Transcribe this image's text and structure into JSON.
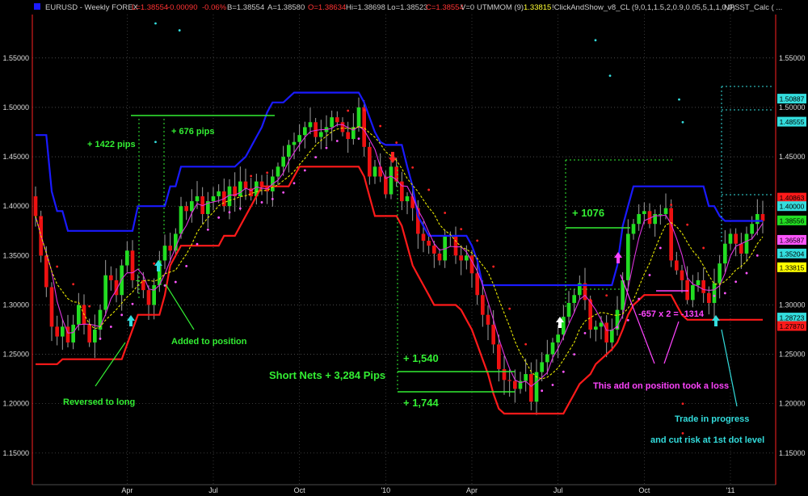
{
  "header": {
    "symbol": "EURUSD - Weekly  FOREX",
    "low": "L=1.38554",
    "change": "-0.00090",
    "change_pct": "-0.06%",
    "bid": "B=1.38554",
    "ask": "A=1.38580",
    "open": "O=1.38634",
    "high": "Hi=1.38698",
    "lo": "Lo=1.38523",
    "close": "C=1.38554",
    "volume": "V=0",
    "indicator": "UTMMOM (9)",
    "indicator_value": "1.33815",
    "study": "!ClickAndShow_v8_CL (9,0,1,1.5,2,0.9,0.05,5,1,1,0,0)",
    "study2": "NPSST_Calc ( ..."
  },
  "colors": {
    "background": "#000000",
    "upper_band": "#1a1aff",
    "lower_band": "#ff1a1a",
    "bull_candle": "#22dd22",
    "bear_candle": "#ee1111",
    "wick": "#a0a0a0",
    "trend_dash": "#e6e600",
    "ma_line": "#dd33dd",
    "annotation_green": "#33ee33",
    "annotation_magenta": "#ff44ff",
    "annotation_cyan": "#33dddd",
    "dot_magenta": "#ff55ff",
    "dot_red": "#ff2222",
    "dot_cyan": "#33dddd",
    "grid": "#ffffff"
  },
  "chart_data": {
    "type": "candlestick",
    "y_ticks": [
      "1.55000",
      "1.50000",
      "1.45000",
      "1.40000",
      "1.35000",
      "1.30000",
      "1.25000",
      "1.20000",
      "1.15000"
    ],
    "x_ticks": [
      "Apr",
      "Jul",
      "Oct",
      "'10",
      "Apr",
      "Jul",
      "Oct",
      "'11"
    ],
    "ylim": [
      1.118,
      1.594
    ],
    "grid": true,
    "price_labels": [
      {
        "text": "1.50887",
        "value": 1.50887,
        "bg": "#33dddd",
        "fg": "#000000"
      },
      {
        "text": "1.48555",
        "value": 1.48555,
        "bg": "#33dddd",
        "fg": "#000000"
      },
      {
        "text": "1.40863",
        "value": 1.40863,
        "bg": "#ff1a1a",
        "fg": "#000000"
      },
      {
        "text": "1.40000",
        "value": 1.4,
        "bg": "#33dddd",
        "fg": "#000000"
      },
      {
        "text": "1.38556",
        "value": 1.38556,
        "bg": "#22dd22",
        "fg": "#000000"
      },
      {
        "text": "1.36587",
        "value": 1.36587,
        "bg": "#ff55ff",
        "fg": "#000000"
      },
      {
        "text": "1.35204",
        "value": 1.35204,
        "bg": "#33dddd",
        "fg": "#000000"
      },
      {
        "text": "1.33815",
        "value": 1.33815,
        "bg": "#ffff00",
        "fg": "#000000"
      },
      {
        "text": "1.28723",
        "value": 1.28723,
        "bg": "#33dddd",
        "fg": "#000000"
      },
      {
        "text": "1.27870",
        "value": 1.2787,
        "bg": "#ff1a1a",
        "fg": "#000000"
      }
    ],
    "closes": [
      1.39,
      1.35,
      1.318,
      1.278,
      1.268,
      1.278,
      1.262,
      1.28,
      1.3,
      1.28,
      1.262,
      1.275,
      1.295,
      1.33,
      1.325,
      1.31,
      1.34,
      1.355,
      1.325,
      1.325,
      1.315,
      1.3,
      1.32,
      1.345,
      1.36,
      1.355,
      1.372,
      1.4,
      1.395,
      1.405,
      1.41,
      1.392,
      1.405,
      1.41,
      1.415,
      1.4,
      1.42,
      1.41,
      1.425,
      1.418,
      1.41,
      1.425,
      1.42,
      1.415,
      1.43,
      1.44,
      1.45,
      1.462,
      1.465,
      1.472,
      1.48,
      1.485,
      1.47,
      1.475,
      1.48,
      1.49,
      1.485,
      1.475,
      1.468,
      1.48,
      1.5,
      1.46,
      1.43,
      1.44,
      1.43,
      1.412,
      1.44,
      1.425,
      1.405,
      1.41,
      1.398,
      1.372,
      1.365,
      1.36,
      1.352,
      1.345,
      1.37,
      1.37,
      1.35,
      1.345,
      1.35,
      1.332,
      1.31,
      1.29,
      1.28,
      1.26,
      1.235,
      1.224,
      1.223,
      1.215,
      1.223,
      1.23,
      1.202,
      1.232,
      1.242,
      1.25,
      1.262,
      1.27,
      1.288,
      1.302,
      1.31,
      1.322,
      1.305,
      1.275,
      1.278,
      1.282,
      1.262,
      1.275,
      1.295,
      1.325,
      1.372,
      1.382,
      1.392,
      1.395,
      1.382,
      1.392,
      1.392,
      1.398,
      1.345,
      1.335,
      1.325,
      1.305,
      1.32,
      1.325,
      1.312,
      1.302,
      1.322,
      1.342,
      1.362,
      1.372,
      1.362,
      1.352,
      1.372,
      1.382,
      1.392,
      1.385
    ],
    "upper_band": [
      1.472,
      1.472,
      1.472,
      1.415,
      1.395,
      1.395,
      1.375,
      1.375,
      1.375,
      1.375,
      1.375,
      1.375,
      1.375,
      1.375,
      1.375,
      1.375,
      1.375,
      1.375,
      1.375,
      1.4,
      1.4,
      1.4,
      1.4,
      1.4,
      1.4,
      1.42,
      1.42,
      1.44,
      1.44,
      1.44,
      1.44,
      1.44,
      1.44,
      1.44,
      1.44,
      1.44,
      1.44,
      1.44,
      1.445,
      1.45,
      1.46,
      1.47,
      1.48,
      1.495,
      1.505,
      1.505,
      1.505,
      1.51,
      1.515,
      1.515,
      1.515,
      1.515,
      1.515,
      1.515,
      1.515,
      1.515,
      1.515,
      1.515,
      1.515,
      1.515,
      1.515,
      1.505,
      1.49,
      1.475,
      1.465,
      1.462,
      1.462,
      1.462,
      1.462,
      1.44,
      1.42,
      1.39,
      1.38,
      1.37,
      1.37,
      1.37,
      1.37,
      1.37,
      1.37,
      1.37,
      1.37,
      1.36,
      1.345,
      1.32,
      1.32,
      1.32,
      1.32,
      1.32,
      1.32,
      1.32,
      1.32,
      1.32,
      1.32,
      1.32,
      1.32,
      1.32,
      1.32,
      1.32,
      1.32,
      1.32,
      1.32,
      1.32,
      1.32,
      1.32,
      1.32,
      1.32,
      1.32,
      1.32,
      1.34,
      1.38,
      1.4,
      1.42,
      1.42,
      1.42,
      1.42,
      1.42,
      1.42,
      1.42,
      1.42,
      1.42,
      1.42,
      1.42,
      1.42,
      1.42,
      1.42,
      1.4,
      1.4,
      1.39,
      1.385,
      1.385,
      1.385,
      1.385,
      1.385,
      1.385,
      1.385,
      1.385
    ],
    "lower_band": [
      1.24,
      1.24,
      1.24,
      1.24,
      1.24,
      1.245,
      1.245,
      1.245,
      1.245,
      1.245,
      1.245,
      1.245,
      1.245,
      1.245,
      1.245,
      1.245,
      1.245,
      1.26,
      1.275,
      1.29,
      1.29,
      1.29,
      1.29,
      1.29,
      1.31,
      1.34,
      1.35,
      1.36,
      1.36,
      1.36,
      1.36,
      1.36,
      1.36,
      1.36,
      1.36,
      1.37,
      1.37,
      1.37,
      1.38,
      1.39,
      1.4,
      1.41,
      1.42,
      1.42,
      1.42,
      1.42,
      1.42,
      1.42,
      1.43,
      1.44,
      1.44,
      1.44,
      1.44,
      1.44,
      1.44,
      1.44,
      1.44,
      1.44,
      1.44,
      1.44,
      1.44,
      1.43,
      1.41,
      1.39,
      1.39,
      1.39,
      1.39,
      1.39,
      1.38,
      1.36,
      1.34,
      1.33,
      1.32,
      1.31,
      1.3,
      1.3,
      1.3,
      1.3,
      1.3,
      1.295,
      1.285,
      1.275,
      1.26,
      1.245,
      1.23,
      1.21,
      1.195,
      1.19,
      1.19,
      1.19,
      1.19,
      1.19,
      1.19,
      1.19,
      1.19,
      1.19,
      1.19,
      1.19,
      1.19,
      1.2,
      1.21,
      1.22,
      1.225,
      1.23,
      1.24,
      1.245,
      1.25,
      1.255,
      1.262,
      1.275,
      1.29,
      1.3,
      1.305,
      1.31,
      1.31,
      1.31,
      1.31,
      1.31,
      1.31,
      1.3,
      1.29,
      1.285,
      1.285,
      1.285,
      1.285,
      1.285,
      1.285,
      1.285,
      1.285,
      1.285,
      1.285,
      1.285,
      1.285,
      1.285,
      1.285,
      1.285
    ]
  },
  "annotations": {
    "pips_1422": "+ 1422 pips",
    "pips_676": "+ 676 pips",
    "added_to_position": "Added to position",
    "reversed_to_long": "Reversed to long",
    "short_nets": "Short Nets + 3,284 Pips",
    "plus_1540": "+ 1,540",
    "plus_1744": "+ 1,744",
    "plus_1076": "+ 1076",
    "loss_calc": "-657 x 2 =  -1314",
    "loss_note": "This add on position took a loss",
    "trade_progress": "Trade in progress",
    "cut_risk": "and cut risk at 1st dot level"
  }
}
